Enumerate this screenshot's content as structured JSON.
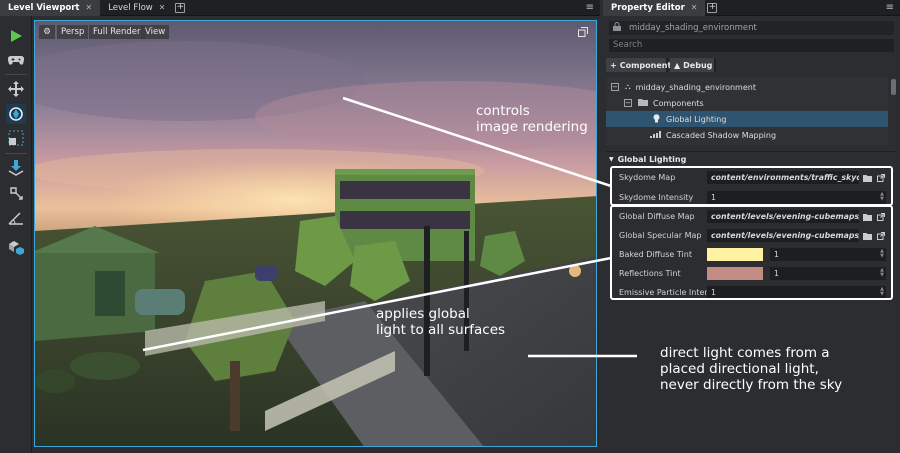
{
  "left_tabs": [
    {
      "label": "Level Viewport",
      "active": true
    },
    {
      "label": "Level Flow",
      "active": false
    }
  ],
  "right_tabs": [
    {
      "label": "Property Editor",
      "active": true
    }
  ],
  "viewport": {
    "buttons": [
      "Persp",
      "Full Render",
      "View"
    ]
  },
  "property_editor": {
    "entity_name": "midday_shading_environment",
    "search_placeholder": "Search",
    "add_component_label": "Component",
    "debug_label": "Debug",
    "tree": [
      {
        "label": "midday_shading_environment",
        "level": 0
      },
      {
        "label": "Components",
        "level": 1
      },
      {
        "label": "Global Lighting",
        "level": 2,
        "selected": true
      },
      {
        "label": "Cascaded Shadow Mapping",
        "level": 2
      }
    ],
    "section_title": "Global Lighting",
    "props": {
      "skydome_map": {
        "label": "Skydome Map",
        "value": "content/environments/traffic_skydome"
      },
      "skydome_intensity": {
        "label": "Skydome Intensity",
        "value": "1"
      },
      "global_diffuse_map": {
        "label": "Global Diffuse Map",
        "value": "content/levels/evening-cubemaps/reflecti"
      },
      "global_specular_map": {
        "label": "Global Specular Map",
        "value": "content/levels/evening-cubemaps/reflecti"
      },
      "baked_diffuse_tint": {
        "label": "Baked Diffuse Tint",
        "value": "1",
        "color": "#fff3a2"
      },
      "reflections_tint": {
        "label": "Reflections Tint",
        "value": "1",
        "color": "#c28b84"
      },
      "emissive_particle_intensity": {
        "label": "Emissive Particle Intensity",
        "value": "1"
      }
    }
  },
  "annotations": {
    "controls": "controls\nimage rendering",
    "applies": "applies global\nlight to all surfaces",
    "direct": "direct light comes from a\nplaced directional light,\nnever directly from the sky"
  },
  "colors": {
    "accent_blue": "#3fa7d8",
    "play_green": "#5fc84a",
    "selection": "#2f5470"
  },
  "icons": [
    "play-icon",
    "gamepad-icon",
    "move-icon",
    "snap-icon",
    "scale-icon",
    "drop-icon",
    "pivot-icon",
    "angle-icon",
    "cubes-icon",
    "gear-icon",
    "maximize-icon",
    "lock-icon",
    "folder-icon",
    "link-icon",
    "bulb-icon",
    "chart-icon"
  ]
}
